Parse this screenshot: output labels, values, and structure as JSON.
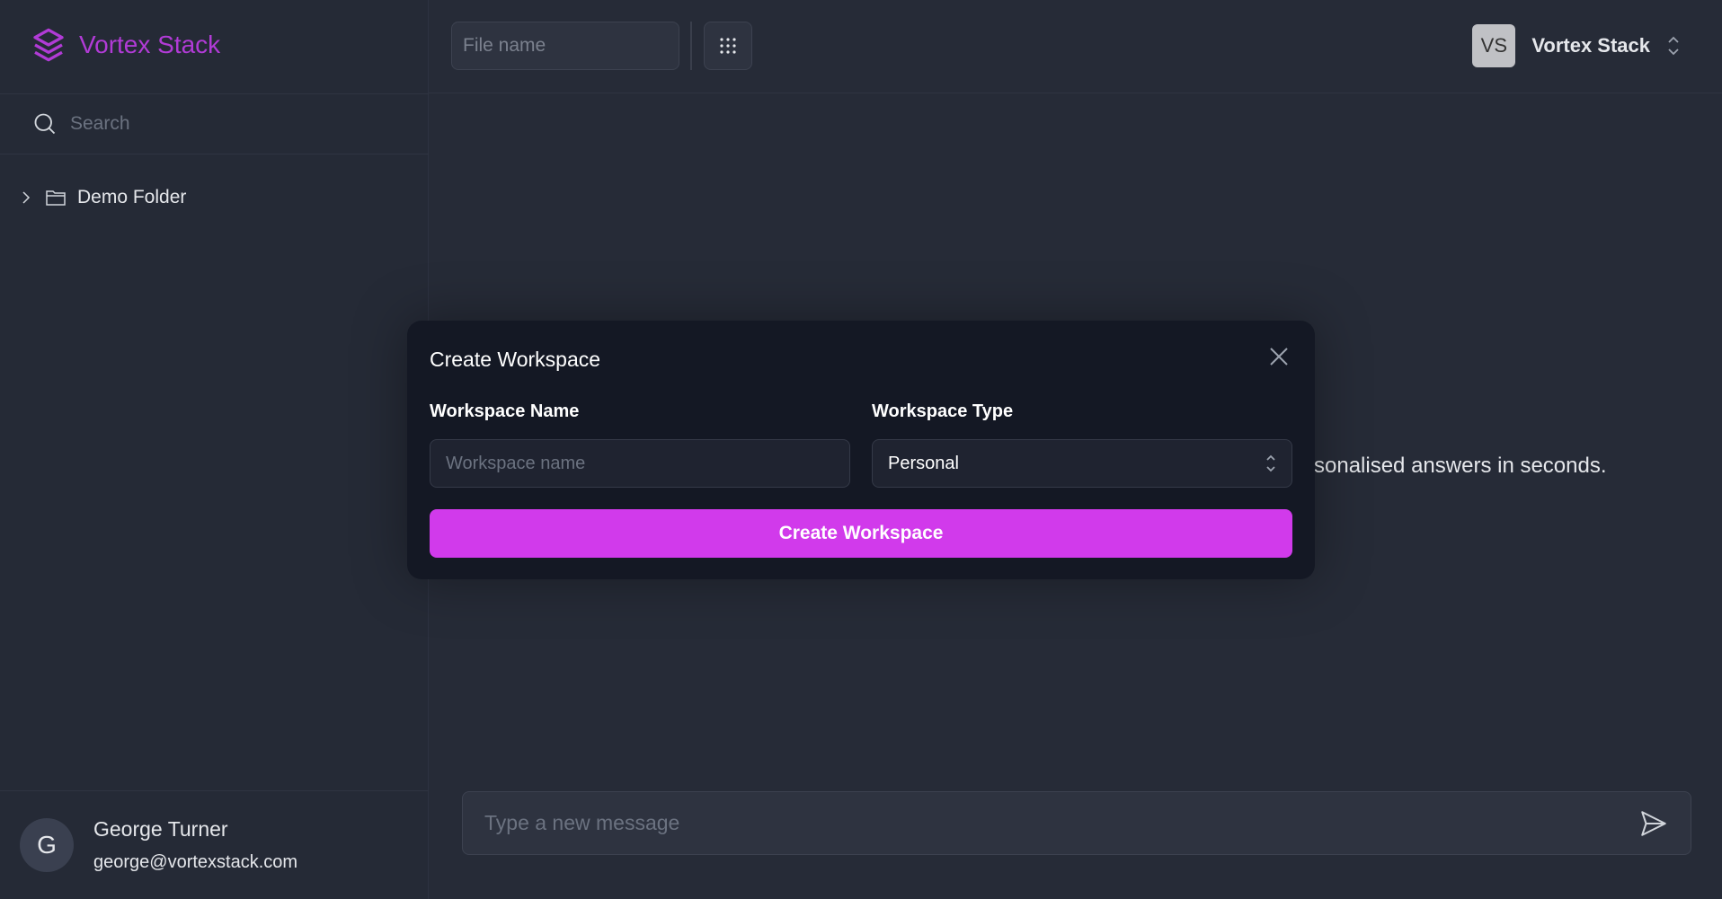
{
  "app": {
    "name": "Vortex Stack",
    "brand_color": "#b13bd6",
    "accent": "#d13aeb"
  },
  "sidebar": {
    "search_placeholder": "Search",
    "tree": [
      {
        "label": "Demo Folder",
        "icon": "folder-icon",
        "expanded": false
      }
    ],
    "user": {
      "initial": "G",
      "name": "George Turner",
      "email": "george@vortexstack.com"
    }
  },
  "header": {
    "file_name_placeholder": "File name",
    "workspace": {
      "initials": "VS",
      "name": "Vortex Stack"
    }
  },
  "main": {
    "background_text": "sonalised answers in seconds.",
    "message_placeholder": "Type a new message"
  },
  "modal": {
    "title": "Create Workspace",
    "name_label": "Workspace Name",
    "name_placeholder": "Workspace name",
    "type_label": "Workspace Type",
    "type_value": "Personal",
    "submit_label": "Create Workspace"
  }
}
